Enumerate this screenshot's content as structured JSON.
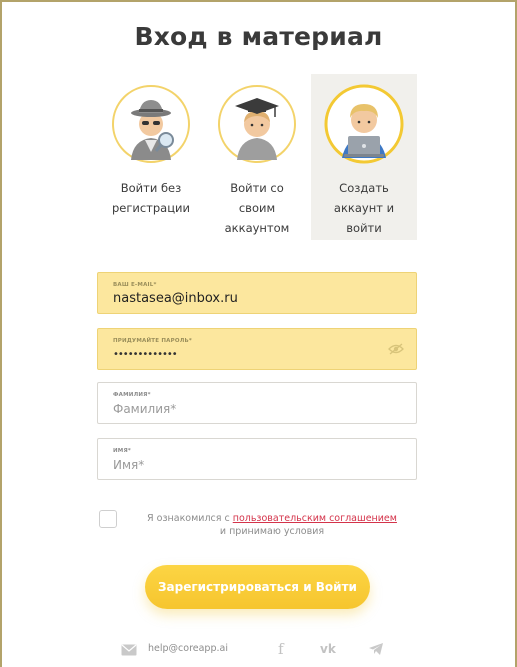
{
  "title": "Вход в материал",
  "options": [
    {
      "label": "Войти без\nрегистрации",
      "icon": "spy-avatar-icon",
      "active": false
    },
    {
      "label": "Войти со\nсвоим\nаккаунтом",
      "icon": "graduate-avatar-icon",
      "active": false
    },
    {
      "label": "Создать\nаккаунт и\nвойти",
      "icon": "laptop-user-avatar-icon",
      "active": true
    }
  ],
  "form": {
    "email": {
      "label": "ВАШ E-MAIL*",
      "value": "nastasea@inbox.ru"
    },
    "password": {
      "label": "ПРИДУМАЙТЕ ПАРОЛЬ*",
      "value": "•••••••••••••"
    },
    "surname": {
      "label": "ФАМИЛИЯ*",
      "placeholder": "Фамилия*"
    },
    "name": {
      "label": "ИМЯ*",
      "placeholder": "Имя*"
    }
  },
  "agreement": {
    "prefix": "Я ознакомился с ",
    "link": "пользовательским соглашением",
    "suffix": "и принимаю условия",
    "checked": false
  },
  "submit_label": "Зарегистрироваться и Войти",
  "footer": {
    "email": "help@coreapp.ai",
    "facebook_glyph": "f",
    "vk_glyph": "vk"
  },
  "colors": {
    "accent": "#f8cb33",
    "field_filled": "#fce79e",
    "link": "#d4334a",
    "frame": "#b3a36a"
  }
}
